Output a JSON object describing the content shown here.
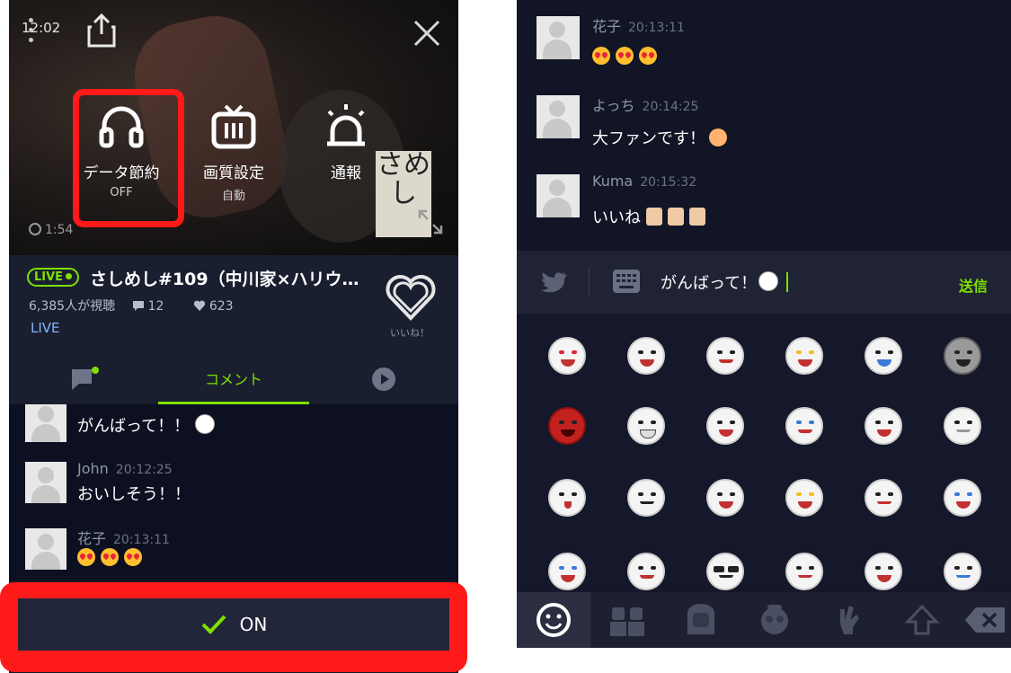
{
  "left_screen": {
    "status_time": "12:02",
    "menu": [
      {
        "label": "データ節約",
        "sub": "OFF",
        "icon": "headphones-icon"
      },
      {
        "label": "画質設定",
        "sub": "自動",
        "icon": "tv-icon"
      },
      {
        "label": "通報",
        "sub": "",
        "icon": "alarm-icon"
      }
    ],
    "video_duration": "1:54",
    "channel_logo_text": "さめし",
    "live_badge": "LIVE",
    "title": "さしめし#109（中川家×ハリウ…",
    "viewers": "6,385人が視聴",
    "comments_count": "12",
    "likes_count": "623",
    "status": "LIVE",
    "like_label": "いいね！",
    "tabs": {
      "comment": "コメント"
    },
    "comments": [
      {
        "name": "",
        "time": "",
        "text": "がんばって！！",
        "emoji": [
          "face"
        ]
      },
      {
        "name": "John",
        "time": "20:12:25",
        "text": "おいしそう！！",
        "emoji": []
      },
      {
        "name": "花子",
        "time": "20:13:11",
        "text": "",
        "emoji": [
          "heart-eyes",
          "heart-eyes",
          "heart-eyes"
        ]
      }
    ],
    "on_button": "ON"
  },
  "right_screen": {
    "comments": [
      {
        "name": "花子",
        "time": "20:13:11",
        "text": "",
        "emoji": [
          "heart-eyes",
          "heart-eyes",
          "heart-eyes"
        ]
      },
      {
        "name": "よっち",
        "time": "20:14:25",
        "text": "大ファンです！",
        "emoji": [
          "blush"
        ]
      },
      {
        "name": "Kuma",
        "time": "20:15:32",
        "text": "いいね",
        "emoji": [
          "thumbs-up",
          "thumbs-up",
          "thumbs-up"
        ]
      }
    ],
    "input_value": "がんばって！",
    "send_label": "送信",
    "emoji_tab_icons": [
      "smiley-icon",
      "people-icon",
      "person-icon",
      "face-icon",
      "hand-icon",
      "shift-icon",
      "backspace-icon"
    ]
  },
  "colors": {
    "accent": "#7ee000",
    "highlight": "#ff1a1a",
    "background": "#141826"
  }
}
